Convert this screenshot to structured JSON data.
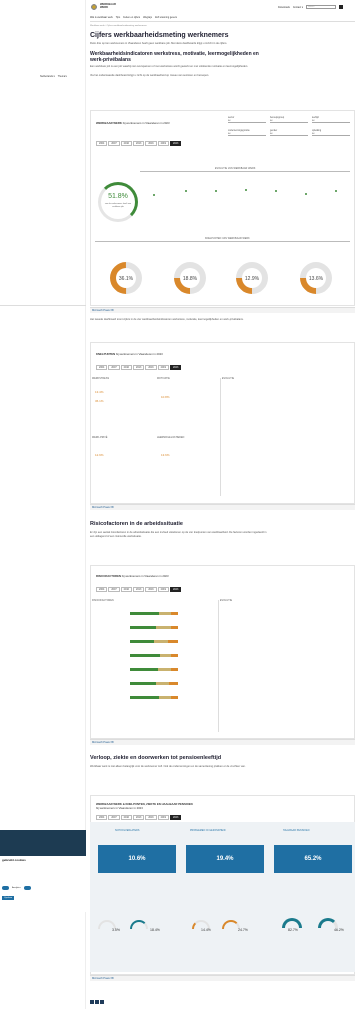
{
  "left_panel": {
    "nav_links": [
      "Netherlands ▾",
      "Thema's"
    ],
    "cookie_title": "gebruikt cookies",
    "cookie_toggle_label": "Analytics",
    "cookie_button": "Opslaan"
  },
  "header": {
    "logo_text_1": "WERKBAAR",
    "logo_text_2": "WERK",
    "nav_right": [
      "Downloads",
      "Contact ▾"
    ],
    "search_placeholder": "zoeken",
    "menu": [
      "Wat is werkbaar werk",
      "Tips",
      "Feiten en cijfers",
      "Wegwijs",
      "Zelf scanning gevers"
    ],
    "breadcrumb": "Werkbaar werk  ›  Cijfers werkbaarheidsmeting werknemers"
  },
  "page": {
    "title": "Cijfers werkbaarheidsmeting werknemers",
    "intro": "Ruim drie op tien werknemers in Vlaanderen heeft geen werkbare job. Met deze dashboards krijgt u inzicht in de cijfers.",
    "section1_title": "Werkbaarheidsindicatoren werkstress, motivatie, leermogelijkheden en werk-privébalans",
    "section1_text1": "Een werkbare job is een job waarbij niet overspannen of met werkstress wordt gewerkt en met voldoende motivatie en leermogelijkheden.",
    "section1_text2": "Via het onderstaande dashboard krijgt u zicht op de werkbaarheid op niveau van sectoren en beroepen.",
    "section2_text": "Het tweede dashboard toont cijfers in de vier werkbaarheidsindicatoren werkstress, motivatie, leermogelijkheden en werk-privébalans.",
    "section3_title": "Risicofactoren in de arbeidssituatie",
    "section3_text": "Er zijn een aantal risicofactoren in de arbeidssituatie die een invloed uitoefenen op de vier knelpunten van werkbaarheid. De factoren worden ingedeeld in een uitdagend of een risicovolle werksituatie.",
    "section4_title": "Verloop, ziekte en doorwerken tot pensioenleeftijd",
    "section4_text": "Werkbaar werk is niet alleen belangrijk voor de werknemer zelf. Ook de ondernemingen en de samenleving plukken er de vruchten van."
  },
  "dashboard1": {
    "title_bold": "WERKBAAR WERK",
    "title_rest": "bij werknemers in Vlaanderen in 2023",
    "years": [
      "2004",
      "2007",
      "2010",
      "2013",
      "2016",
      "2019",
      "2023"
    ],
    "active_year": "2023",
    "filters": [
      "sector",
      "beroepsgroep",
      "leeftijd",
      "ondernemingsgrootte",
      "gender",
      "opleiding"
    ],
    "filter_value": "All",
    "main_value": "51.8%",
    "main_caption": "van de werknemers heeft een werkbare job",
    "evolution_label": "EVOLUTIE VAN WERKBAAR WERK",
    "knelpunten_label": "KNELPUNTEN VAN WERKBAAR WERK",
    "indicators": [
      "WERKSTRESS",
      "MOTIVATIEPROBLEMEN",
      "GEBREK LEERMOG.",
      "WERK-PRIVÉ"
    ],
    "indicator_values": [
      "36.1%",
      "18.8%",
      "12.9%",
      "13.6%"
    ],
    "footer": "Microsoft Power BI"
  },
  "dashboard2": {
    "title_bold": "KNELPUNTEN",
    "title_rest": "bij werknemers in Vlaanderen in 2023",
    "labels": [
      "WERKSTRESS",
      "MOTIVATIE",
      "EVOLUTIE",
      "WERK-PRIVÉ",
      "LEERMOGELIJKHEDEN"
    ],
    "values": [
      "13.4%",
      "36.1%",
      "10.8%",
      "12.9%",
      "13.6%"
    ],
    "footer": "Microsoft Power BI"
  },
  "dashboard3": {
    "title_bold": "RISICOFACTOREN",
    "title_rest": "bij werknemers in Vlaanderen in 2023",
    "left_label": "RISICOFACTOREN",
    "right_label": "EVOLUTIE",
    "footer": "Microsoft Power BI"
  },
  "dashboard4": {
    "title_bold": "WERKBAAR WERK & KNELPUNTEN, ZIEKTE EN HAALBAAR PENSIOEN",
    "title_rest": "bij werknemers in Vlaanderen in 2023",
    "cards": [
      "SCHOOLVERLATERS",
      "PROBLEMEN IN GEZONDHEID",
      "HAALBAAR PENSIOEN"
    ],
    "big_values": [
      "10.6%",
      "19.4%",
      "65.2%"
    ],
    "small_values": [
      "3.5%",
      "18.4%",
      "14.4%",
      "24.7%",
      "82.7%",
      "46.2%"
    ],
    "footer": "Microsoft Power BI"
  },
  "colors": {
    "accent": "#1f6fa3",
    "orange": "#d9882b",
    "green": "#3f8b3a",
    "teal": "#1a7a8c"
  }
}
